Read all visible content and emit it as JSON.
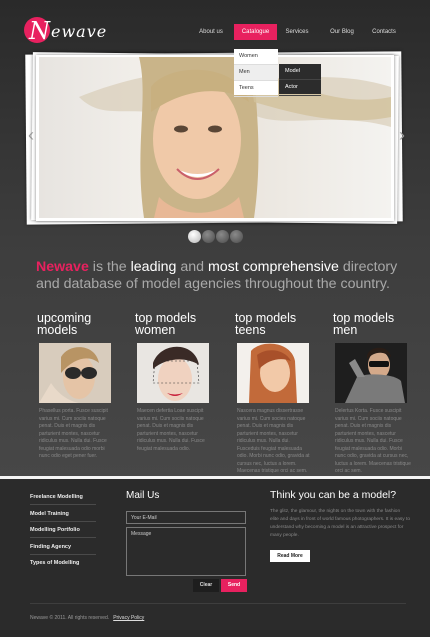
{
  "logo": {
    "initial": "N",
    "rest": "ewave"
  },
  "nav": {
    "items": [
      {
        "label": "About us"
      },
      {
        "label": "Catalogue"
      },
      {
        "label": "Services"
      },
      {
        "label": "Our Blog"
      },
      {
        "label": "Contacts"
      }
    ],
    "dropdown": [
      "Women",
      "Men",
      "Teens"
    ],
    "submenu": [
      "Model",
      "Actor"
    ]
  },
  "slider": {
    "dots": 4,
    "active_dot": 1
  },
  "tagline": {
    "brand": "Newave",
    "t1": " is the ",
    "h1": "leading",
    "t2": " and ",
    "h2": "most comprehensive",
    "t3": " directory and database of model agencies throughout the country."
  },
  "columns": [
    {
      "title1": "upcoming",
      "title2": "models",
      "text": "Phasellus porta. Fusce suscipit varius mi. Cum sociis natoque penat. Duis et magnis dis parturient montes, nascetur ridiculus mus. Nulla dui. Fusce feugiat malesuada odio morbi nunc odio eget pener fuer."
    },
    {
      "title1": "top models",
      "title2": "women",
      "text": "Maecen defertia Loae suscipit varius mi. Cum sociis natoque penat. Duis et magnis dis parturient montes, nascetur ridiculus mus. Nulla dui. Fusce feugiat malesuada odio."
    },
    {
      "title1": "top models",
      "title2": "teens",
      "text": "Nascera magnus dissertrasse varius mi. Cum socies natoque penat. Duis et magnis dis parturient montes, nascetur ridiculus mus. Nulla dui. Fusceduis feugiat malesuada odio. Morbi nunc odio, gravida at cursus nec, luctus a lorem. Maecenas tristique orci ac sem. Duis ultricies pharetra magna. Donec accumsan malesuada orci."
    },
    {
      "title1": "top models",
      "title2": "men",
      "text": "Delertus Korta. Fusce suscipit varius mi. Cum sociis natoque penat. Duis et magnis dis parturient montes, nascetur ridiculus mus. Nulla dui. Fusce feugiat malesuada odio. Morbi nunc odio, gravida at cursus nec, luctus a lorem. Maecenas tristique orci ac sem."
    }
  ],
  "footer": {
    "links": [
      "Freelance Modelling",
      "Model Training",
      "Modelling Portfolio",
      "Finding Agency",
      "Types of Modelling"
    ],
    "mail": {
      "title": "Mail Us",
      "email_placeholder": "Your E-Mail",
      "message_placeholder": "Message",
      "clear": "Clear",
      "send": "Send"
    },
    "think": {
      "title": "Think you can be a model?",
      "text": "The glitz, the glamour, the nights on the town with the fashion elite and days in front of world famous photographers. It is easy to understand why becoming a model is an attractive prospect for many people.",
      "button": "Read More"
    },
    "copyright": "Newave © 2011. All rights reserved.",
    "privacy": "Privacy Policy"
  },
  "colors": {
    "accent": "#e8215f",
    "background": "#3a3a3a",
    "footer": "#2b2b2b"
  }
}
